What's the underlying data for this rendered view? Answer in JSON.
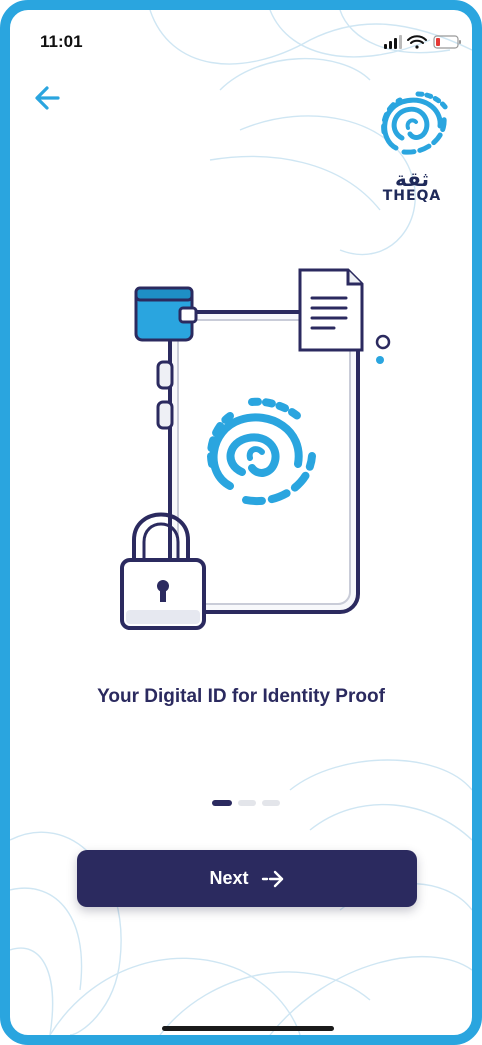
{
  "status_bar": {
    "time": "11:01",
    "icons": [
      "signal-icon",
      "wifi-icon",
      "battery-icon"
    ],
    "battery_color": "#e53935"
  },
  "header": {
    "back_icon": "arrow-left-icon",
    "logo": {
      "arabic_text": "ثقة",
      "wordmark": "THEQA"
    }
  },
  "onboarding": {
    "headline": "Your Digital ID for Identity Proof",
    "illustration": "phone-with-fingerprint-lock-document",
    "pager": {
      "total": 3,
      "current": 1
    }
  },
  "actions": {
    "next_label": "Next",
    "next_icon": "arrow-right-icon"
  },
  "colors": {
    "frame": "#2aa5df",
    "accent": "#2aa5df",
    "primary": "#2b2a5f",
    "background": "#ffffff"
  }
}
